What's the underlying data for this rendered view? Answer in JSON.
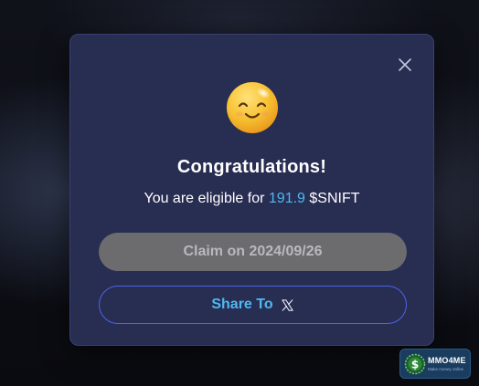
{
  "modal": {
    "title": "Congratulations!",
    "eligible_prefix": "You are eligible for",
    "amount": "191.9",
    "token": "$SNIFT",
    "claim_label": "Claim on 2024/09/26",
    "share_label": "Share To",
    "close_icon": "close-icon",
    "emoji_icon": "smiling-face-emoji",
    "share_icon": "x-logo-icon"
  },
  "watermark": {
    "name": "MMO4ME",
    "tagline": "Make money online"
  },
  "colors": {
    "modal_bg": "#282d52",
    "amount": "#4fb8f0",
    "share_border": "#4d64e6",
    "claim_bg": "#6c6c6f"
  }
}
